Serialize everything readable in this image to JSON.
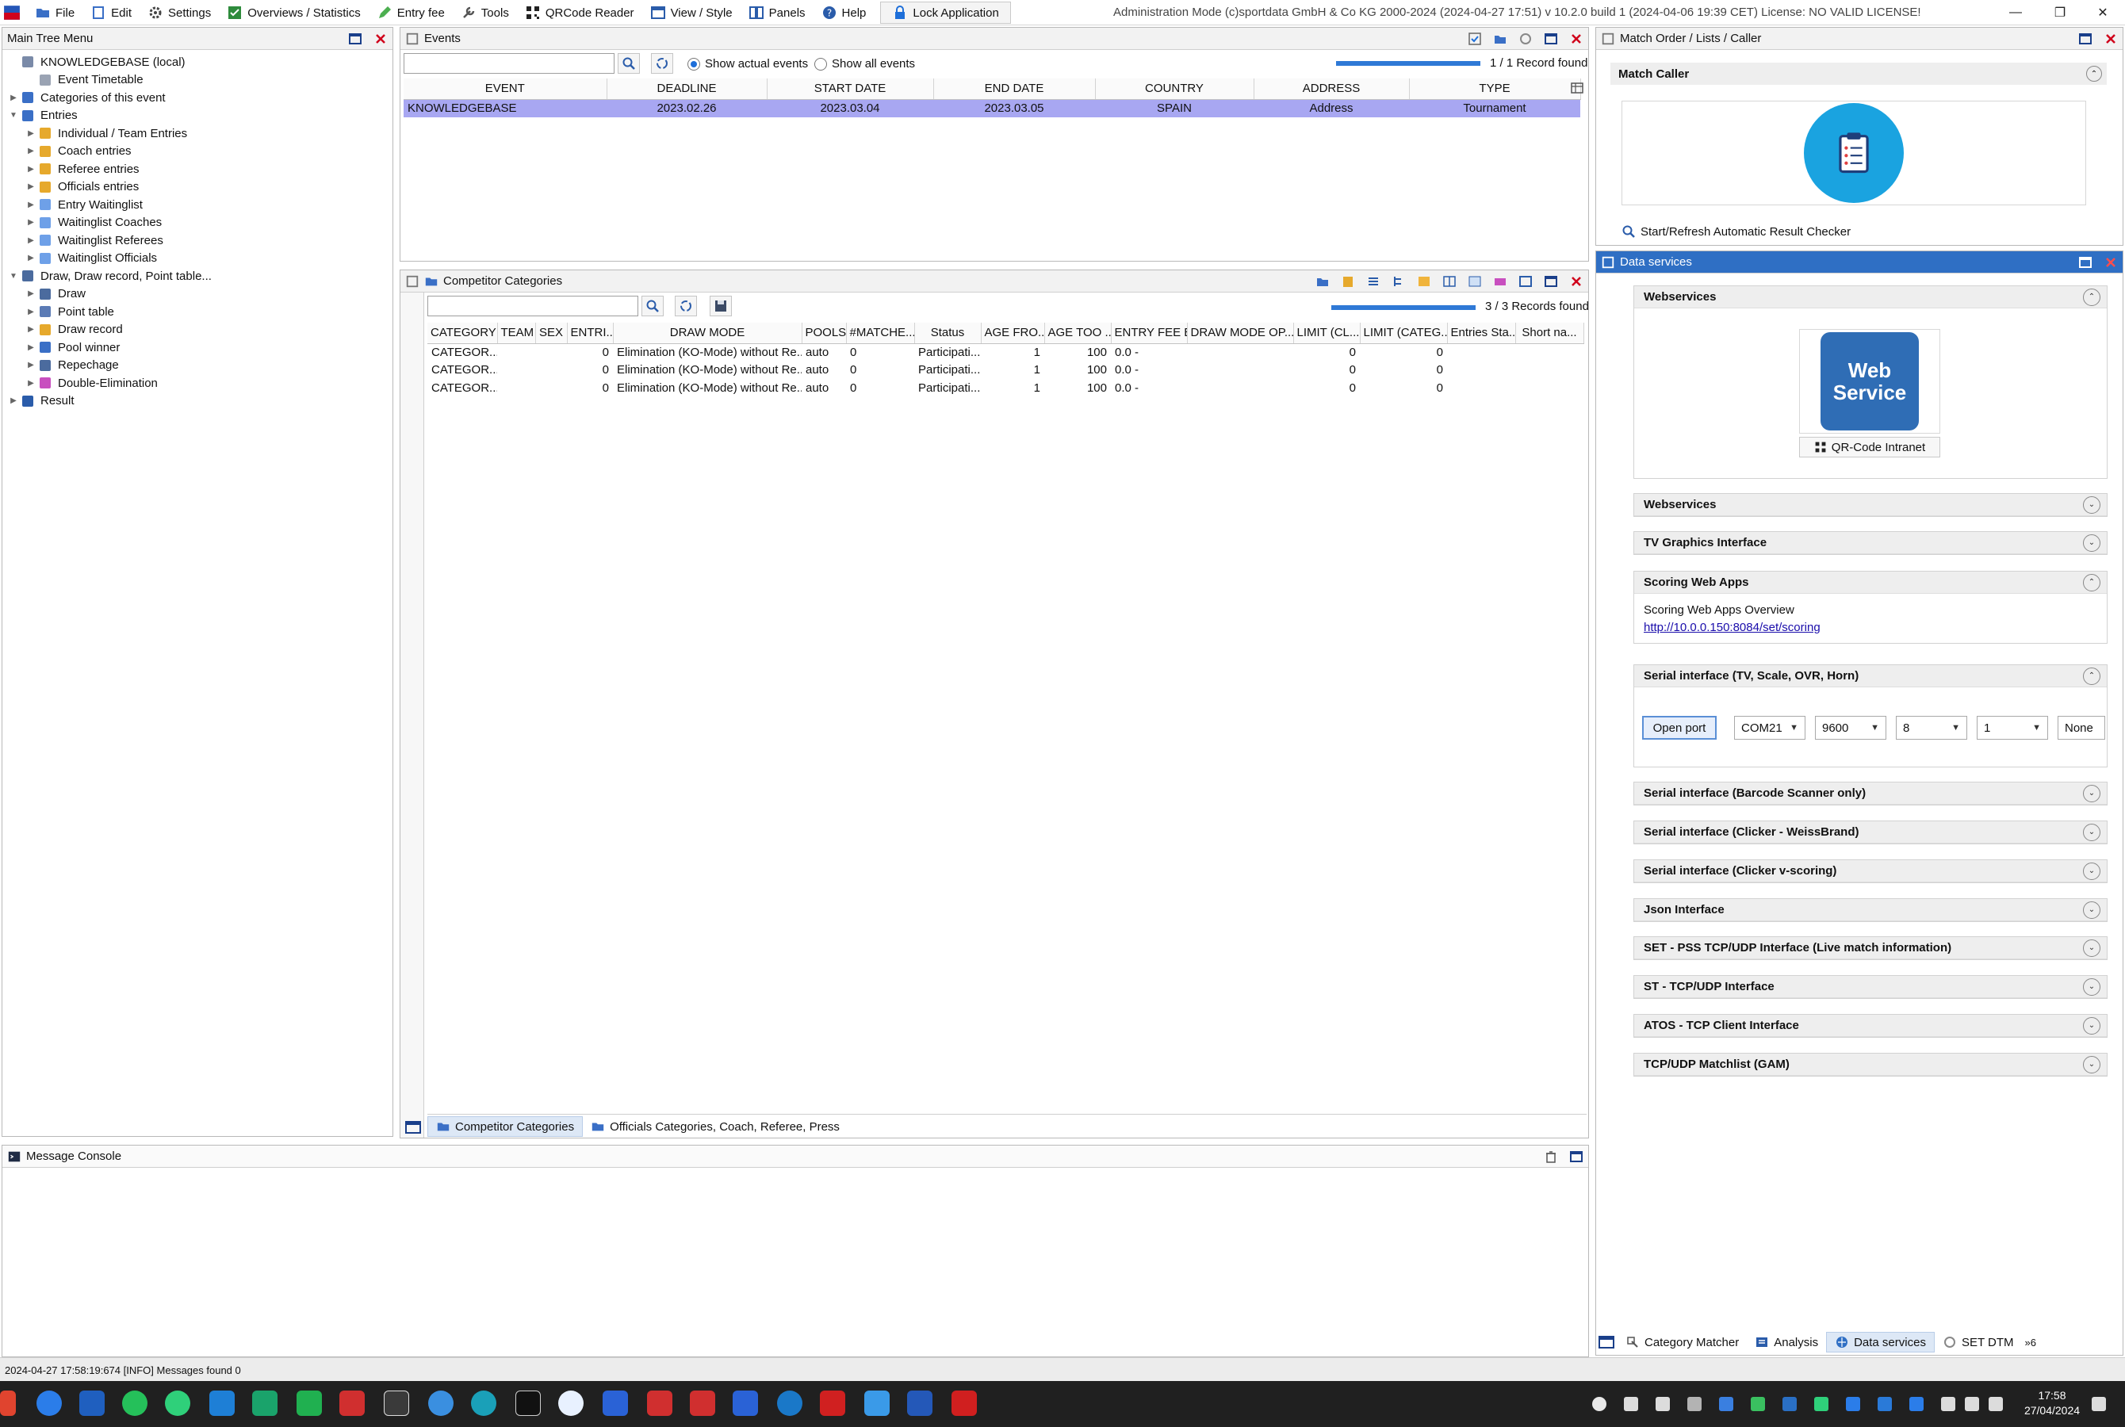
{
  "titlebar": {
    "menu": [
      {
        "label": "File",
        "icon": "folder-icon"
      },
      {
        "label": "Edit",
        "icon": "edit-icon"
      },
      {
        "label": "Settings",
        "icon": "gear-icon"
      },
      {
        "label": "Overviews / Statistics",
        "icon": "check-icon"
      },
      {
        "label": "Entry fee",
        "icon": "pencil-icon"
      },
      {
        "label": "Tools",
        "icon": "wrench-icon"
      },
      {
        "label": "QRCode Reader",
        "icon": "qr-icon"
      },
      {
        "label": "View / Style",
        "icon": "window-icon"
      },
      {
        "label": "Panels",
        "icon": "panels-icon"
      },
      {
        "label": "Help",
        "icon": "help-icon"
      }
    ],
    "lock_label": "Lock Application",
    "app_title": "Administration Mode (c)sportdata GmbH & Co KG 2000-2024 (2024-04-27 17:51)  v 10.2.0 build 1 (2024-04-06 19:39 CET) License: NO VALID LICENSE!",
    "colors": {
      "accent": "#1e6fd9",
      "selected_row": "#a8a7f2",
      "close_red": "#d0021b"
    }
  },
  "tree": {
    "title": "Main Tree Menu",
    "nodes": [
      {
        "label": "KNOWLEDGEBASE (local)",
        "level": 0,
        "toggle": "",
        "icon": "database-icon"
      },
      {
        "label": "Event Timetable",
        "level": 1,
        "toggle": "",
        "icon": "clock-icon"
      },
      {
        "label": "Categories of this event",
        "level": 0,
        "toggle": "▶",
        "icon": "categories-icon"
      },
      {
        "label": "Entries",
        "level": 0,
        "toggle": "▼",
        "icon": "folder-icon"
      },
      {
        "label": "Individual / Team Entries",
        "level": 1,
        "toggle": "▶",
        "icon": "folder-users-icon"
      },
      {
        "label": "Coach entries",
        "level": 1,
        "toggle": "▶",
        "icon": "folder-users-icon"
      },
      {
        "label": "Referee entries",
        "level": 1,
        "toggle": "▶",
        "icon": "folder-users-icon"
      },
      {
        "label": "Officials entries",
        "level": 1,
        "toggle": "▶",
        "icon": "folder-users-icon"
      },
      {
        "label": "Entry Waitinglist",
        "level": 1,
        "toggle": "▶",
        "icon": "list-icon"
      },
      {
        "label": "Waitinglist Coaches",
        "level": 1,
        "toggle": "▶",
        "icon": "list-icon"
      },
      {
        "label": "Waitinglist Referees",
        "level": 1,
        "toggle": "▶",
        "icon": "list-icon"
      },
      {
        "label": "Waitinglist Officials",
        "level": 1,
        "toggle": "▶",
        "icon": "list-icon"
      },
      {
        "label": "Draw, Draw record, Point table...",
        "level": 0,
        "toggle": "▼",
        "icon": "draw-icon"
      },
      {
        "label": "Draw",
        "level": 1,
        "toggle": "▶",
        "icon": "draw-icon"
      },
      {
        "label": "Point table",
        "level": 1,
        "toggle": "▶",
        "icon": "table-icon"
      },
      {
        "label": "Draw record",
        "level": 1,
        "toggle": "▶",
        "icon": "record-icon"
      },
      {
        "label": "Pool winner",
        "level": 1,
        "toggle": "▶",
        "icon": "grid-icon"
      },
      {
        "label": "Repechage",
        "level": 1,
        "toggle": "▶",
        "icon": "repechage-icon"
      },
      {
        "label": "Double-Elimination",
        "level": 1,
        "toggle": "▶",
        "icon": "double-icon"
      },
      {
        "label": "Result",
        "level": 0,
        "toggle": "▶",
        "icon": "result-icon"
      }
    ]
  },
  "events": {
    "title": "Events",
    "radio_actual": "Show actual events",
    "radio_all": "Show all events",
    "record_count": "1 / 1 Record found",
    "progress": 1.0,
    "columns": [
      "EVENT",
      "DEADLINE",
      "START DATE",
      "END DATE",
      "COUNTRY",
      "ADDRESS",
      "TYPE"
    ],
    "rows": [
      [
        "KNOWLEDGEBASE",
        "2023.02.26",
        "2023.03.04",
        "2023.03.05",
        "SPAIN",
        "Address",
        "Tournament"
      ]
    ]
  },
  "categories": {
    "title": "Competitor Categories",
    "record_count": "3 / 3 Records found",
    "progress": 1.0,
    "columns": [
      "CATEGORY",
      "TEAM",
      "SEX",
      "ENTRI...",
      "DRAW MODE",
      "POOLS",
      "#MATCHE...",
      "Status",
      "AGE FRO...",
      "AGE TOO ...",
      "ENTRY FEE E...",
      "DRAW MODE OP...",
      "LIMIT (CL...",
      "LIMIT (CATEG...",
      "Entries Sta...",
      "Short na..."
    ],
    "rows": [
      [
        "CATEGOR...",
        "",
        "",
        "0",
        "Elimination (KO-Mode) without Re...",
        "auto",
        "0",
        "Participati...",
        "1",
        "100",
        "0.0 -",
        "",
        "0",
        "0",
        "",
        ""
      ],
      [
        "CATEGOR...",
        "",
        "",
        "0",
        "Elimination (KO-Mode) without Re...",
        "auto",
        "0",
        "Participati...",
        "1",
        "100",
        "0.0 -",
        "",
        "0",
        "0",
        "",
        ""
      ],
      [
        "CATEGOR...",
        "",
        "",
        "0",
        "Elimination (KO-Mode) without Re...",
        "auto",
        "0",
        "Participati...",
        "1",
        "100",
        "0.0 -",
        "",
        "0",
        "0",
        "",
        ""
      ]
    ],
    "tabs": [
      "Competitor Categories",
      "Officials Categories, Coach, Referee, Press"
    ]
  },
  "console": {
    "title": "Message Console",
    "status": "2024-04-27 17:58:19:674 [INFO] Messages found 0"
  },
  "match_order": {
    "title": "Match Order / Lists / Caller",
    "section": "Match Caller",
    "checker_label": "Start/Refresh Automatic Result Checker"
  },
  "data_services": {
    "title": "Data services",
    "webservice_label": "Webservices",
    "webservice_logo_top": "Web",
    "webservice_logo_bottom": "Service",
    "qr_button": "QR-Code Intranet",
    "scoring_overview": "Scoring Web Apps Overview",
    "scoring_link": "http://10.0.0.150:8084/set/scoring",
    "open_port": "Open port",
    "serial_values": {
      "port": "COM21",
      "baud": "9600",
      "bits": "8",
      "stop": "1",
      "parity": "None"
    },
    "sections": [
      {
        "label": "Webservices",
        "expanded": false
      },
      {
        "label": "TV Graphics Interface",
        "expanded": false
      },
      {
        "label": "Scoring Web Apps",
        "expanded": true
      },
      {
        "label": "Serial interface (TV, Scale, OVR, Horn)",
        "expanded": true
      },
      {
        "label": "Serial interface (Barcode Scanner only)",
        "expanded": false
      },
      {
        "label": "Serial interface (Clicker - WeissBrand)",
        "expanded": false
      },
      {
        "label": "Serial interface (Clicker v-scoring)",
        "expanded": false
      },
      {
        "label": "Json Interface",
        "expanded": false
      },
      {
        "label": "SET - PSS TCP/UDP Interface (Live match information)",
        "expanded": false
      },
      {
        "label": "ST - TCP/UDP Interface",
        "expanded": false
      },
      {
        "label": "ATOS - TCP Client Interface",
        "expanded": false
      },
      {
        "label": "TCP/UDP Matchlist (GAM)",
        "expanded": false
      }
    ],
    "bottom_tabs": [
      "Category Matcher",
      "Analysis",
      "Data services",
      "SET DTM"
    ],
    "more_tabs": "»6"
  },
  "taskbar": {
    "time": "17:58",
    "date": "27/04/2024"
  }
}
